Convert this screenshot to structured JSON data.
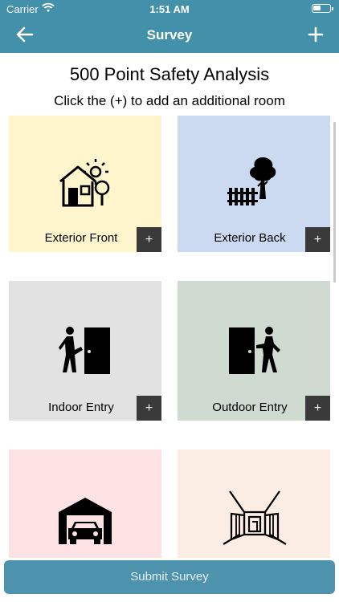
{
  "status_bar": {
    "carrier": "Carrier",
    "time": "1:51 AM"
  },
  "nav": {
    "title": "Survey",
    "back_icon": "arrow-left-icon",
    "add_icon": "plus-icon"
  },
  "header": {
    "title": "500 Point Safety Analysis",
    "subtitle": "Click the (+) to add an additional room"
  },
  "tiles": [
    {
      "label": "Exterior Front",
      "icon": "house-icon",
      "color": "#fef5cc",
      "add": "+"
    },
    {
      "label": "Exterior Back",
      "icon": "tree-fence-icon",
      "color": "#cbdaf0",
      "add": "+"
    },
    {
      "label": "Indoor Entry",
      "icon": "person-door-icon",
      "color": "#e2e2e2",
      "add": "+"
    },
    {
      "label": "Outdoor Entry",
      "icon": "door-person-icon",
      "color": "#cfdbd1",
      "add": "+"
    },
    {
      "label": "",
      "icon": "garage-car-icon",
      "color": "#fce2e2"
    },
    {
      "label": "",
      "icon": "room-perspective-icon",
      "color": "#fcede4"
    }
  ],
  "footer": {
    "submit_label": "Submit Survey"
  },
  "colors": {
    "nav_bar": "#4290aa",
    "submit_button": "#4d93ad"
  }
}
